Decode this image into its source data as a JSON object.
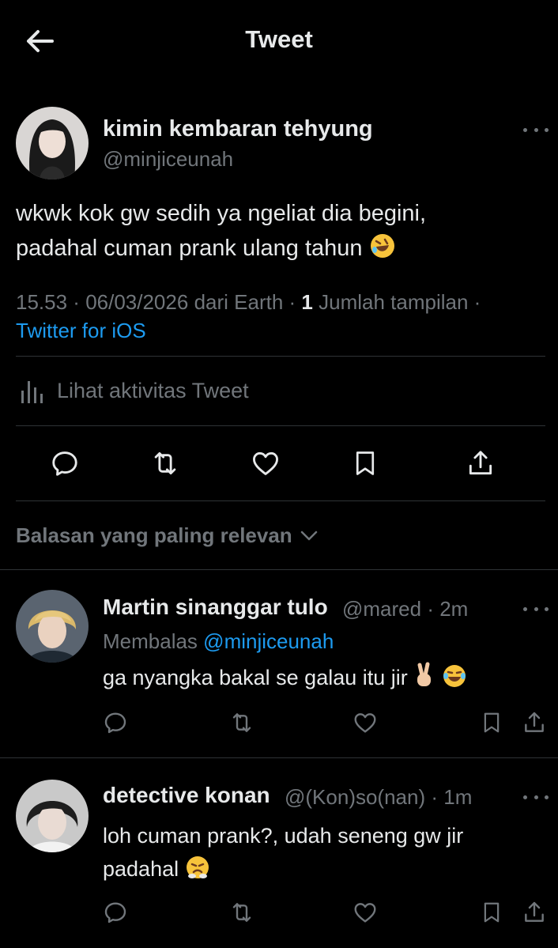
{
  "header": {
    "title": "Tweet",
    "back_icon": "arrow-left-icon"
  },
  "tweet": {
    "author_name": "kimin kembaran tehyung",
    "author_handle": "@minjiceunah",
    "text_line1": "wkwk kok gw sedih ya ngeliat dia begini,",
    "text_line2": "padahal cuman prank ulang tahun",
    "emoji": "rolling-on-floor-laughing",
    "time": "15.53",
    "date": "06/03/2026",
    "location": "dari Earth",
    "views_count": "1",
    "views_label": "Jumlah tampilan",
    "source": "Twitter for iOS",
    "activity_label": "Lihat aktivitas Tweet"
  },
  "sort": {
    "label": "Balasan yang paling relevan"
  },
  "replies": [
    {
      "author_name": "Martin sinanggar tulo",
      "author_handle": "@mared",
      "time": "2m",
      "replying_prefix": "Membalas",
      "replying_to": "@minjiceunah",
      "text": "ga nyangka bakal se galau itu jir"
    },
    {
      "author_name": "detective konan",
      "author_handle": "@(Kon)so(nan)",
      "time": "1m",
      "text_line1": "loh cuman prank?, udah seneng gw jir",
      "text_line2": "padahal"
    }
  ],
  "colors": {
    "background": "#000000",
    "text": "#e7e9ea",
    "muted": "#71767b",
    "accent": "#1d9bf0",
    "divider": "#2f3336"
  }
}
